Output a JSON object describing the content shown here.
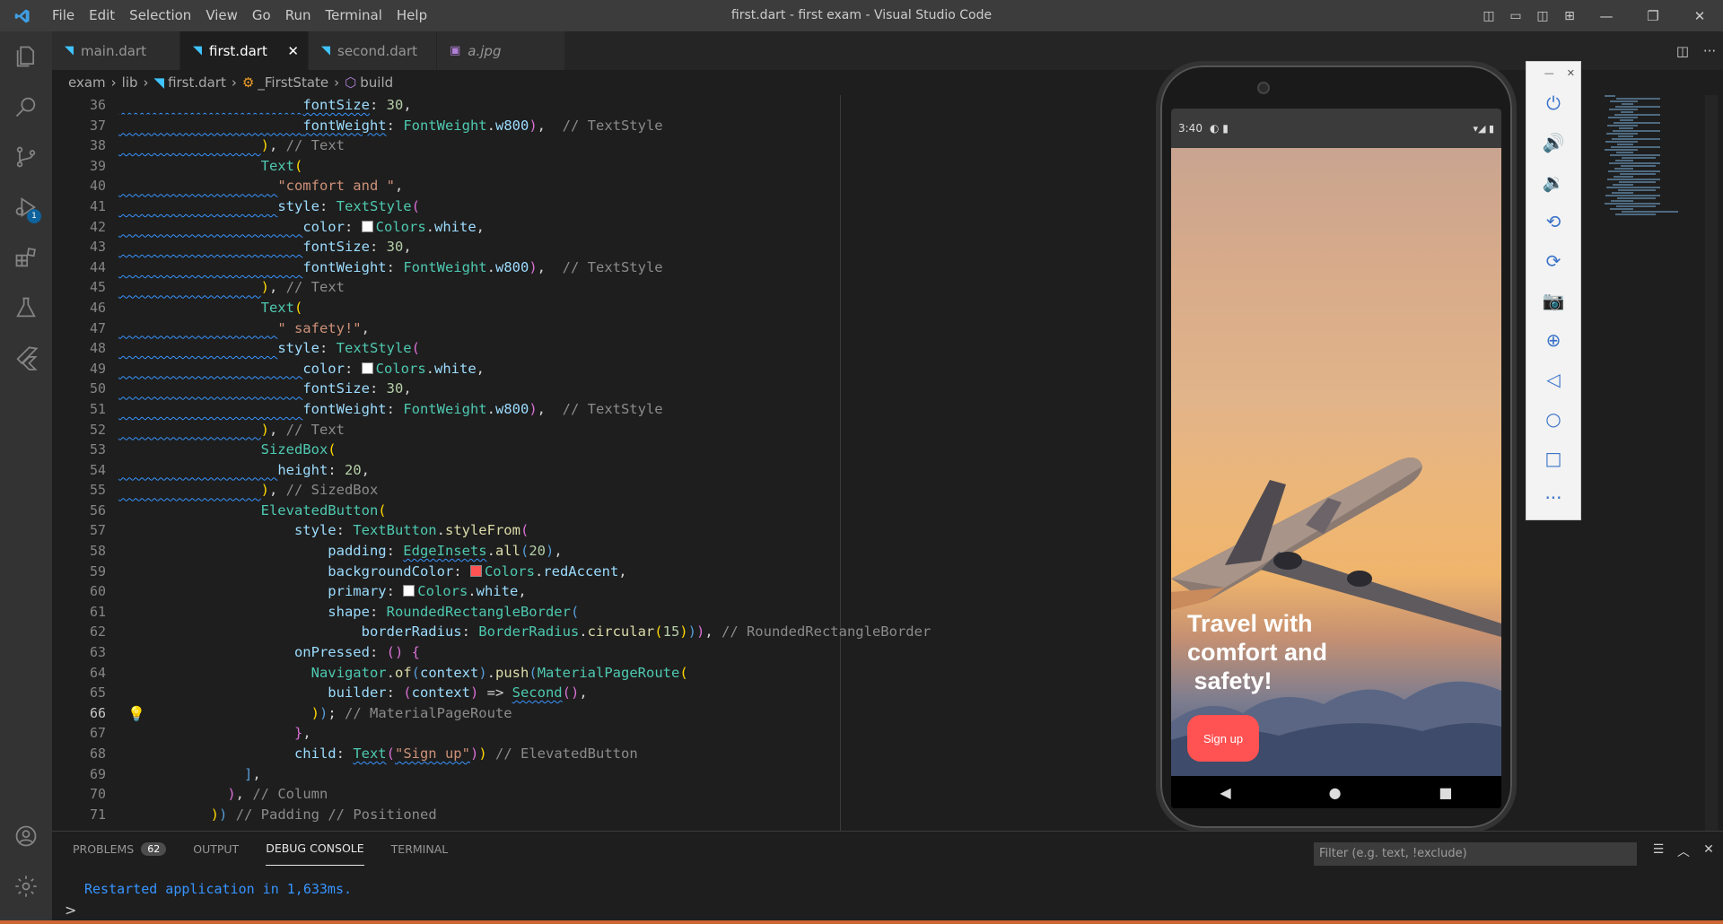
{
  "menu": [
    "File",
    "Edit",
    "Selection",
    "View",
    "Go",
    "Run",
    "Terminal",
    "Help"
  ],
  "window_title": "first.dart - first exam - Visual Studio Code",
  "tabs": [
    {
      "label": "main.dart"
    },
    {
      "label": "first.dart"
    },
    {
      "label": "second.dart"
    },
    {
      "label": "a.jpg"
    }
  ],
  "breadcrumb": [
    "exam",
    "lib",
    "first.dart",
    "_FirstState",
    "build"
  ],
  "activity_badge": "1",
  "line_numbers": [
    "36",
    "37",
    "38",
    "39",
    "40",
    "41",
    "42",
    "43",
    "44",
    "45",
    "46",
    "47",
    "48",
    "49",
    "50",
    "51",
    "52",
    "53",
    "54",
    "55",
    "56",
    "57",
    "58",
    "59",
    "60",
    "61",
    "62",
    "63",
    "64",
    "65",
    "66",
    "67",
    "68",
    "69",
    "70",
    "71"
  ],
  "current_line": "66",
  "code_comments": {
    "textstyle": "// TextStyle",
    "text": "// Text",
    "sizedbox": "// SizedBox",
    "rounded": "// RoundedRectangleBorder",
    "mpr": "// MaterialPageRoute",
    "elevated": "// ElevatedButton",
    "column": "// Column",
    "padding_positioned": "// Padding // Positioned"
  },
  "phone": {
    "time": "3:40",
    "headline": "Travel with\ncomfort and\n safety!",
    "button_label": "Sign up"
  },
  "panel": {
    "tabs": [
      "PROBLEMS",
      "OUTPUT",
      "DEBUG CONSOLE",
      "TERMINAL"
    ],
    "problems_count": "62",
    "filter_placeholder": "Filter (e.g. text, !exclude)",
    "console_output": "Restarted application in 1,633ms.",
    "prompt": ">"
  },
  "colors": {
    "accent": "#007acc",
    "button_red": "#ff5252",
    "console_text": "#3794ff"
  }
}
